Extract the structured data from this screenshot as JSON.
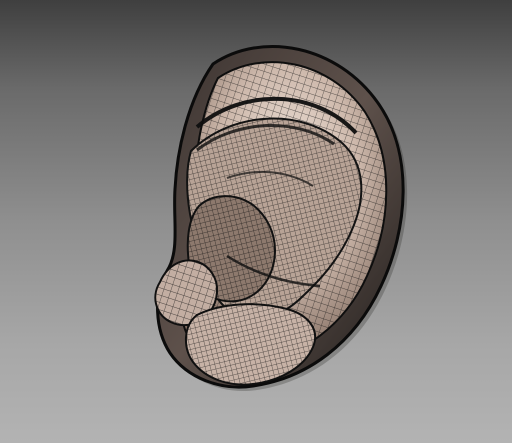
{
  "viewport": {
    "background_top": "#3f3f3f",
    "background_bottom": "#b3b3b3"
  },
  "model": {
    "subject": "ear-wireframe-model",
    "mesh_line_color": "#111111",
    "surface_color": "#cdb8ab",
    "surface_highlight": "#efe3da",
    "surface_shadow": "#8a7569"
  }
}
